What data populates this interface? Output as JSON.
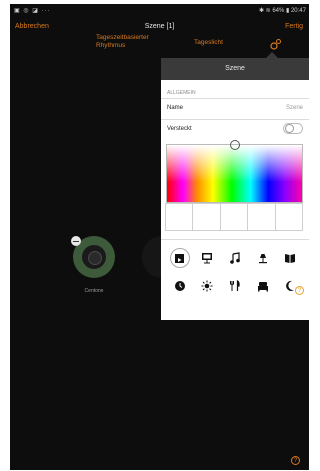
{
  "statusbar": {
    "left": "▣ ◎ ◪  ···",
    "right": "✱ ≋ 64% ▮ 20:47"
  },
  "nav": {
    "cancel": "Abbrechen",
    "title": "Szene [1]",
    "done": "Fertig"
  },
  "tabs": {
    "rhythm": "Tageszeitbasierter Rhythmus",
    "daylight": "Tageslicht"
  },
  "lamps": [
    {
      "label": "Centone"
    }
  ],
  "popover": {
    "title": "Szene",
    "section": "ALLGEMEIN",
    "name_label": "Name",
    "name_value": "Szene",
    "hidden_label": "Versteckt",
    "hidden_on": false,
    "help": "?",
    "icons": [
      "scene-clapper-icon",
      "presentation-icon",
      "music-note-icon",
      "lamp-icon",
      "book-icon",
      "clock-icon",
      "sun-icon",
      "cutlery-icon",
      "sofa-icon",
      "moon-icon"
    ]
  },
  "help_bottom": "?",
  "accent_color": "#d97a1f"
}
